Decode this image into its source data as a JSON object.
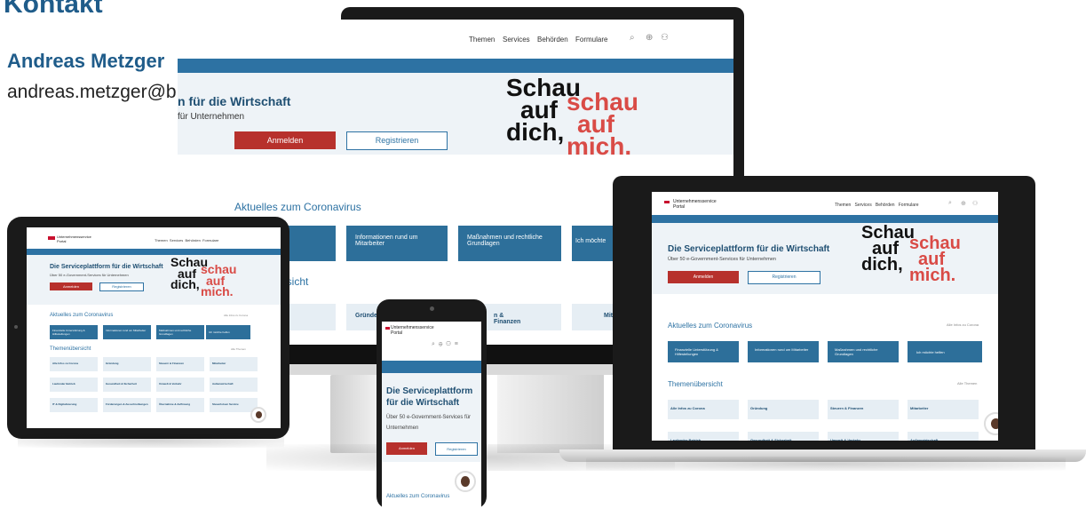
{
  "contact": {
    "title": "Kontakt",
    "name": "Andreas Metzger",
    "email": "andreas.metzger@brz.gv.at"
  },
  "portal": {
    "name_line1": "Unternehmensservice",
    "name_line2": "Portal",
    "nav": [
      "Themen",
      "Services",
      "Behörden",
      "Formulare"
    ],
    "hero_title": "Die Serviceplattform für die Wirtschaft",
    "hero_title_line1": "Die Serviceplattform",
    "hero_title_line2": "für die Wirtschaft",
    "hero_title_partial": "n für die Wirtschaft",
    "hero_subtitle": "Über 50 e-Government-Services für Unternehmen",
    "hero_subtitle_partial": "für Unternehmen",
    "hero_subtitle_line1": "Über 50 e-Government-Services für",
    "hero_subtitle_line2": "Unternehmen",
    "login_button": "Anmelden",
    "register_button": "Registrieren",
    "slogan": {
      "w1": "Schau",
      "w2": "auf",
      "w3": "dich,",
      "r1": "schau",
      "r2": "auf",
      "r3": "mich."
    },
    "corona_heading": "Aktuelles zum Coronavirus",
    "corona_more": "Alle Infos zu Corona",
    "corona_tiles": [
      "Finanzielle Unterstützung & Hilfestellungen",
      "Informationen rund um Mitarbeiter",
      "Maßnahmen und rechtliche Grundlagen",
      "Ich möchte helfen"
    ],
    "topics_heading": "Themenübersicht",
    "topics_more": "Alle Themen",
    "topics": [
      "Alle Infos zu Corona",
      "Gründung",
      "Steuern & Finanzen",
      "Mitarbeiter",
      "Laufender Betrieb",
      "Gesundheit & Sicherheit",
      "Umwelt & Verkehr",
      "Außenwirtschaft",
      "IT & Digitalisierung",
      "Förderungen & Ausschreibungen",
      "Übernahme & Auflösung",
      "Steuerlotsen Service"
    ],
    "monitor_corona_tiles": [
      "erstützung &",
      "Informationen rund um Mitarbeiter",
      "Maßnahmen und rechtliche Grundlagen",
      "Ich möchte"
    ],
    "monitor_topics_heading": "ersicht",
    "monitor_topics": [
      "ona",
      "Gründe",
      "n & Finanzen",
      "Mitarbeiter"
    ]
  }
}
